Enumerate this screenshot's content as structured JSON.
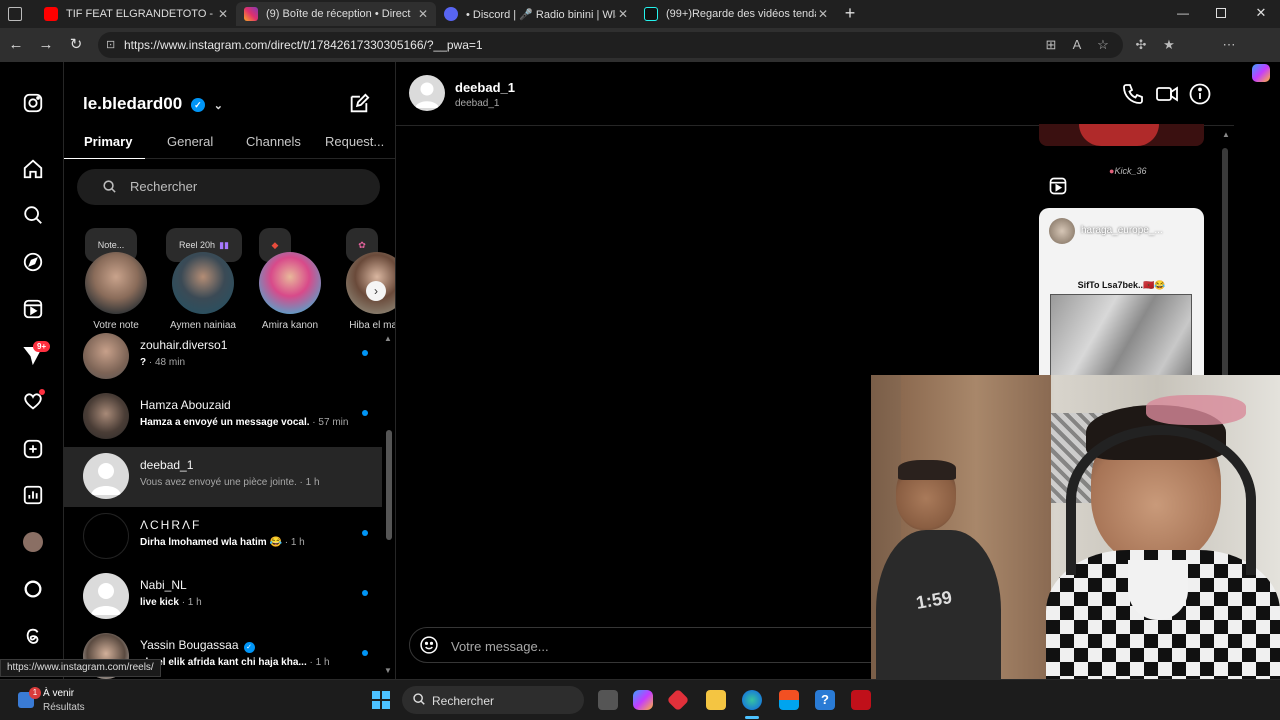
{
  "browser": {
    "tabs": [
      {
        "title": "TIF FEAT ELGRANDETOTO - KAFIN",
        "favicon_color": "#ff0000"
      },
      {
        "title": "(9) Boîte de réception • Direct",
        "favicon_color": "#e1306c"
      },
      {
        "title": "• Discord | 🎤 Radio binini | Wlad",
        "favicon_color": "#5865f2"
      },
      {
        "title": "(99+)Regarde des vidéos tendanc",
        "favicon_color": "#111111"
      }
    ],
    "url": "https://www.instagram.com/direct/t/17842617330305166/?__pwa=1"
  },
  "sidebar": {
    "notification_badge": "9+"
  },
  "inbox": {
    "username": "le.bledard00",
    "tabs": [
      "Primary",
      "General",
      "Channels",
      "Request..."
    ],
    "search_placeholder": "Rechercher",
    "stories": [
      {
        "note": "Note...",
        "name": "Votre note"
      },
      {
        "note": "Reel 20h",
        "name": "Aymen nainiaa"
      },
      {
        "note": "",
        "name": "Amira kanon"
      },
      {
        "note": "",
        "name": "Hiba el majd"
      }
    ],
    "conversations": [
      {
        "name": "zouhair.diverso1",
        "preview": "?",
        "time": " · 48 min",
        "unread": true,
        "selected": false
      },
      {
        "name": "Hamza Abouzaid",
        "preview": "Hamza a envoyé un message vocal.",
        "time": " · 57 min",
        "unread": true,
        "selected": false
      },
      {
        "name": "deebad_1",
        "preview": "Vous avez envoyé une pièce jointe.",
        "time": " · 1 h",
        "unread": false,
        "selected": true
      },
      {
        "name": "ΛCHRΛF",
        "preview": "Dirha lmohamed wla hatim 😂",
        "time": " · 1 h",
        "unread": true,
        "selected": false
      },
      {
        "name": "Nabi_NL",
        "preview": "live kick",
        "time": " · 1 h",
        "unread": true,
        "selected": false
      },
      {
        "name": "Yassin Bougassaa",
        "preview": "sheel elik afrida kant chi haja kha...",
        "time": " · 1 h",
        "unread": true,
        "selected": false
      }
    ]
  },
  "chat": {
    "name": "deebad_1",
    "handle": "deebad_1",
    "input_placeholder": "Votre message...",
    "reel_user": "haraga_europe_...",
    "reel_caption": "SifTo Lsa7bek..🇲🇦😂",
    "reel_top_label": "Kick_36"
  },
  "status_bar_url": "https://www.instagram.com/reels/",
  "taskbar": {
    "weather_title": "À venir",
    "weather_sub": "Résultats",
    "search_placeholder": "Rechercher",
    "notification_count": "1"
  }
}
